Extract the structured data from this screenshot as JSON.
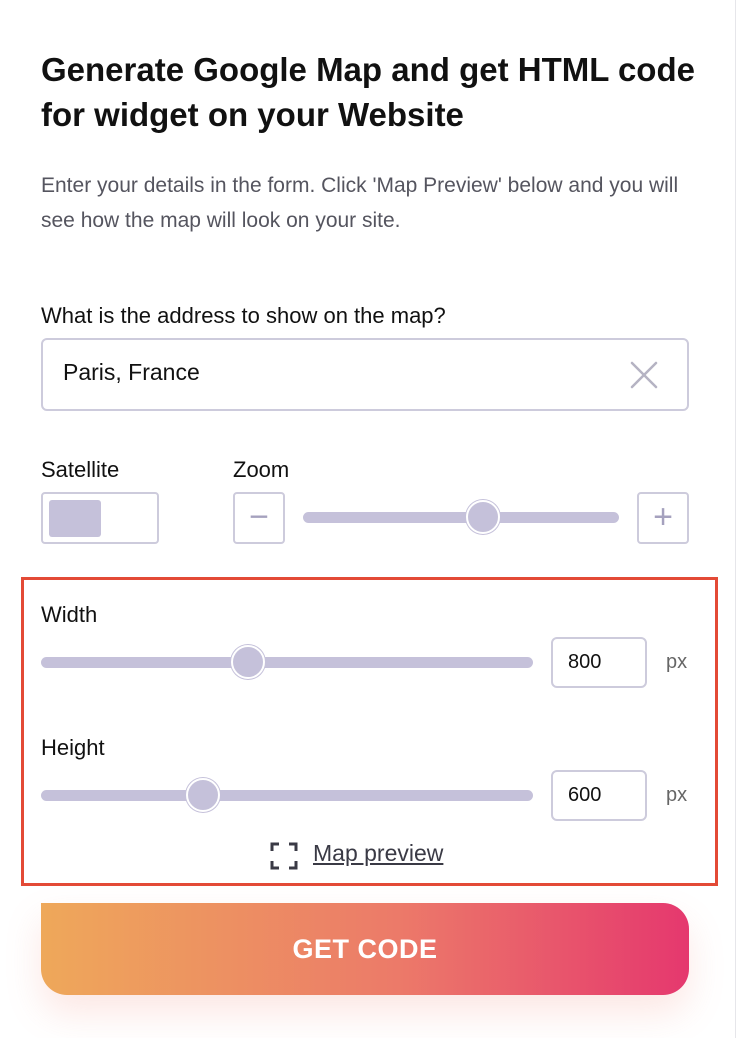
{
  "header": {
    "title": "Generate Google Map and get HTML code for widget on your Website",
    "subtitle": "Enter your details in the form. Click 'Map Preview' below and you will see how the map will look on your site."
  },
  "address": {
    "label": "What is the address to show on the map?",
    "value": "Paris, France"
  },
  "satellite": {
    "label": "Satellite",
    "enabled": false
  },
  "zoom": {
    "label": "Zoom",
    "minus": "−",
    "plus": "+",
    "level": 0.57
  },
  "width": {
    "label": "Width",
    "value": "800",
    "unit": "px",
    "slider_level": 0.42
  },
  "height": {
    "label": "Height",
    "value": "600",
    "unit": "px",
    "slider_level": 0.33
  },
  "preview": {
    "label": "Map preview",
    "icon": "fullscreen-icon"
  },
  "cta": {
    "label": "GET CODE"
  },
  "colors": {
    "accent_start": "#eea85a",
    "accent_end": "#e5386e",
    "control": "#c5c1da",
    "highlight": "#e34a36"
  }
}
